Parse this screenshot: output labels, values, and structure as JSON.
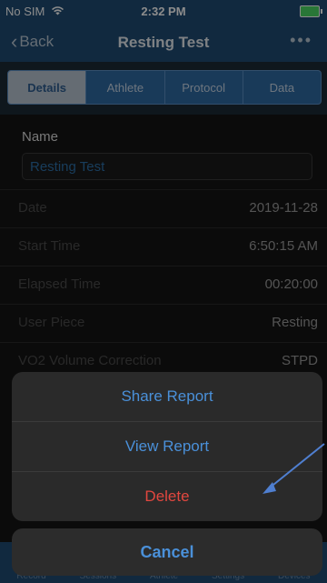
{
  "status_bar": {
    "carrier": "No SIM",
    "time": "2:32 PM"
  },
  "nav": {
    "back_label": "Back",
    "title": "Resting Test",
    "more_label": "•••"
  },
  "segments": [
    {
      "label": "Details",
      "active": true
    },
    {
      "label": "Athlete",
      "active": false
    },
    {
      "label": "Protocol",
      "active": false
    },
    {
      "label": "Data",
      "active": false
    }
  ],
  "details": {
    "name_label": "Name",
    "name_value": "Resting Test",
    "rows": [
      {
        "label": "Date",
        "value": "2019-11-28"
      },
      {
        "label": "Start Time",
        "value": "6:50:15 AM"
      },
      {
        "label": "Elapsed Time",
        "value": "00:20:00"
      },
      {
        "label": "User Piece",
        "value": "Resting"
      },
      {
        "label": "VO2 Volume Correction",
        "value": "STPD"
      }
    ]
  },
  "bottom_tabs": [
    "Record",
    "Sessions",
    "Athlete",
    "Settings",
    "Devices"
  ],
  "action_sheet": {
    "share_label": "Share Report",
    "view_label": "View Report",
    "delete_label": "Delete",
    "cancel_label": "Cancel"
  },
  "colors": {
    "nav_blue": "#1f4b73",
    "action_blue": "#4a90d9",
    "destructive_red": "#e2473f",
    "arrow": "#4f7fd0"
  },
  "icons": [
    "wifi-icon",
    "battery-icon",
    "chevron-left-icon",
    "more-icon",
    "arrow-pointer-icon"
  ]
}
